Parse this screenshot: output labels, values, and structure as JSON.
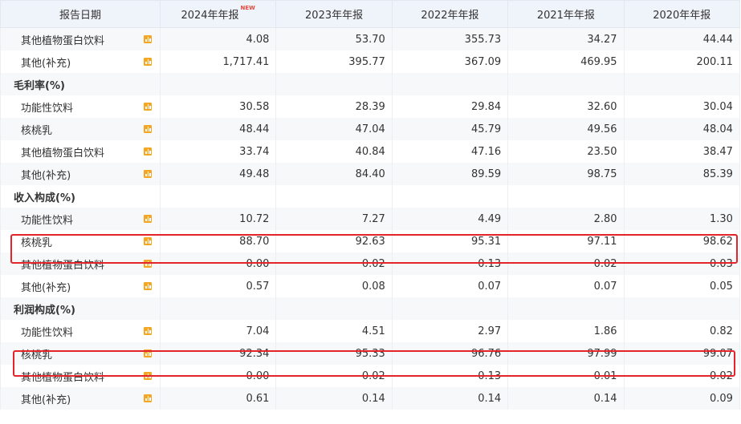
{
  "header": {
    "col0": "报告日期",
    "years": [
      "2024年年报",
      "2023年年报",
      "2022年年报",
      "2021年年报",
      "2020年年报"
    ],
    "new_badge": "NEW"
  },
  "rows": [
    {
      "type": "item",
      "label": "其他植物蛋白饮料",
      "values": [
        "4.08",
        "53.70",
        "355.73",
        "34.27",
        "44.44"
      ]
    },
    {
      "type": "item",
      "label": "其他(补充)",
      "values": [
        "1,717.41",
        "395.77",
        "367.09",
        "469.95",
        "200.11"
      ]
    },
    {
      "type": "section",
      "label": "毛利率(%)"
    },
    {
      "type": "item",
      "label": "功能性饮料",
      "values": [
        "30.58",
        "28.39",
        "29.84",
        "32.60",
        "30.04"
      ]
    },
    {
      "type": "item",
      "label": "核桃乳",
      "values": [
        "48.44",
        "47.04",
        "45.79",
        "49.56",
        "48.04"
      ]
    },
    {
      "type": "item",
      "label": "其他植物蛋白饮料",
      "values": [
        "33.74",
        "40.84",
        "47.16",
        "23.50",
        "38.47"
      ]
    },
    {
      "type": "item",
      "label": "其他(补充)",
      "values": [
        "49.48",
        "84.40",
        "89.59",
        "98.75",
        "85.39"
      ]
    },
    {
      "type": "section",
      "label": "收入构成(%)"
    },
    {
      "type": "item",
      "label": "功能性饮料",
      "values": [
        "10.72",
        "7.27",
        "4.49",
        "2.80",
        "1.30"
      ]
    },
    {
      "type": "item",
      "label": "核桃乳",
      "values": [
        "88.70",
        "92.63",
        "95.31",
        "97.11",
        "98.62"
      ]
    },
    {
      "type": "item",
      "label": "其他植物蛋白饮料",
      "values": [
        "0.00",
        "0.02",
        "0.13",
        "0.02",
        "0.03"
      ]
    },
    {
      "type": "item",
      "label": "其他(补充)",
      "values": [
        "0.57",
        "0.08",
        "0.07",
        "0.07",
        "0.05"
      ]
    },
    {
      "type": "section",
      "label": "利润构成(%)"
    },
    {
      "type": "item",
      "label": "功能性饮料",
      "values": [
        "7.04",
        "4.51",
        "2.97",
        "1.86",
        "0.82"
      ]
    },
    {
      "type": "item",
      "label": "核桃乳",
      "values": [
        "92.34",
        "95.33",
        "96.76",
        "97.99",
        "99.07"
      ]
    },
    {
      "type": "item",
      "label": "其他植物蛋白饮料",
      "values": [
        "0.00",
        "0.02",
        "0.13",
        "0.01",
        "0.02"
      ]
    },
    {
      "type": "item",
      "label": "其他(补充)",
      "values": [
        "0.61",
        "0.14",
        "0.14",
        "0.14",
        "0.09"
      ]
    }
  ],
  "colors": {
    "header_bg": "#eff3fa",
    "stripe_bg": "#f7f8fa",
    "icon": "#f5a623",
    "highlight": "#e3242b",
    "new_badge": "#e64a3b"
  },
  "icons": {
    "row_chart": "bar-chart-icon"
  }
}
